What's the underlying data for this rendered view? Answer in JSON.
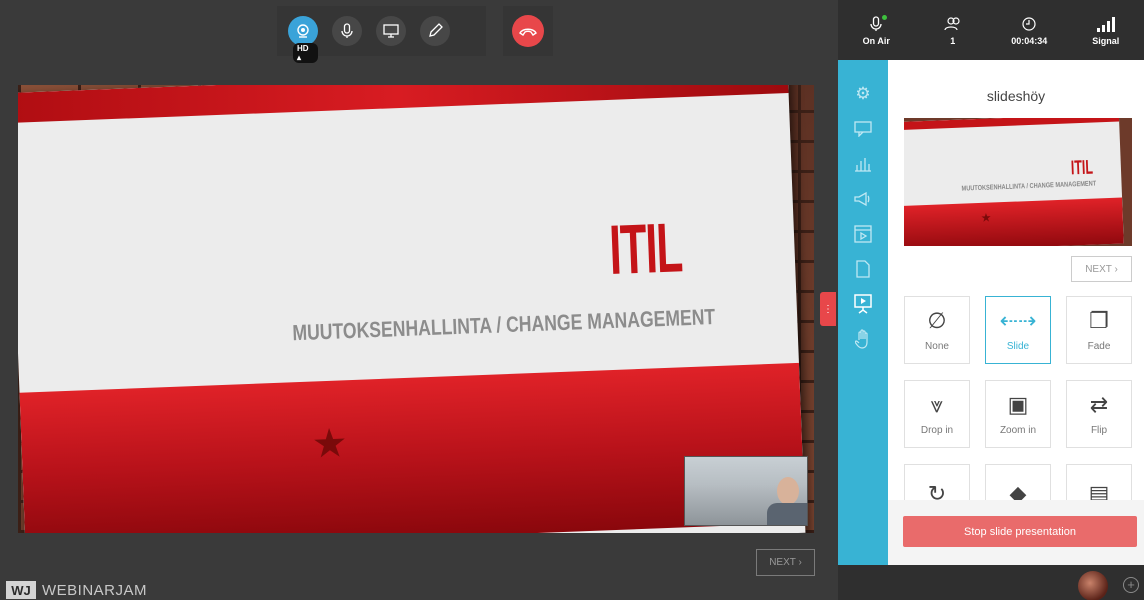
{
  "toolbar": {
    "hd_label": "HD"
  },
  "slide": {
    "title": "ITIL",
    "subtitle": "MUUTOKSENHALLINTA / CHANGE MANAGEMENT"
  },
  "main": {
    "next_label": "NEXT ›"
  },
  "brand": {
    "logo_mark": "WJ",
    "logo_text": "WEBINARJAM"
  },
  "stats": {
    "on_air_label": "On Air",
    "attendees": "1",
    "timer": "00:04:34",
    "signal_label": "Signal"
  },
  "panel": {
    "title": "slideshöy",
    "next_label": "NEXT ›",
    "thumb_title": "ITIL",
    "thumb_subtitle": "MUUTOKSENHALLINTA / CHANGE MANAGEMENT",
    "transitions": [
      {
        "label": "None",
        "icon": "none-icon",
        "glyph": "∅"
      },
      {
        "label": "Slide",
        "icon": "slide-arrows-icon",
        "glyph": "⇠⇢",
        "selected": true
      },
      {
        "label": "Fade",
        "icon": "fade-icon",
        "glyph": "❐"
      },
      {
        "label": "Drop in",
        "icon": "drop-in-icon",
        "glyph": "⩔"
      },
      {
        "label": "Zoom in",
        "icon": "zoom-in-icon",
        "glyph": "▣"
      },
      {
        "label": "Flip",
        "icon": "flip-icon",
        "glyph": "⇄"
      },
      {
        "label": "",
        "icon": "rotate-icon",
        "glyph": "↻"
      },
      {
        "label": "",
        "icon": "diamond-icon",
        "glyph": "◆"
      },
      {
        "label": "",
        "icon": "cube-icon",
        "glyph": "▤"
      }
    ],
    "stop_label": "Stop slide presentation"
  },
  "colors": {
    "accent": "#38b3d4",
    "end_call": "#e8474a",
    "stop_button": "#e96b6b"
  }
}
